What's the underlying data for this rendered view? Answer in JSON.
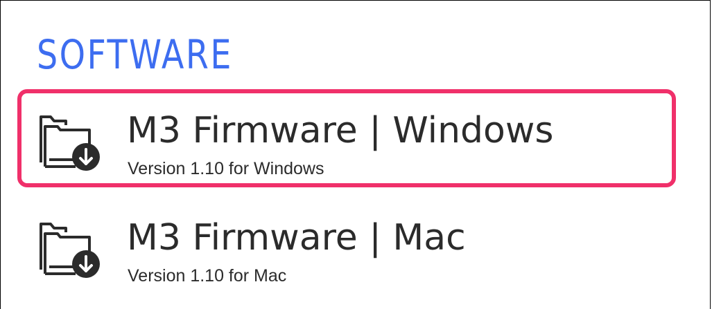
{
  "section": {
    "title": "SOFTWARE"
  },
  "items": [
    {
      "title": "M3 Firmware | Windows",
      "subtitle": "Version 1.10 for Windows",
      "icon": "folder-download-icon",
      "highlighted": true
    },
    {
      "title": "M3 Firmware | Mac",
      "subtitle": "Version 1.10 for Mac",
      "icon": "folder-download-icon",
      "highlighted": false
    }
  ],
  "colors": {
    "title_blue": "#3d6df0",
    "highlight_border": "#f0306a",
    "text": "#2b2b2b",
    "icon": "#2b2b2b"
  }
}
